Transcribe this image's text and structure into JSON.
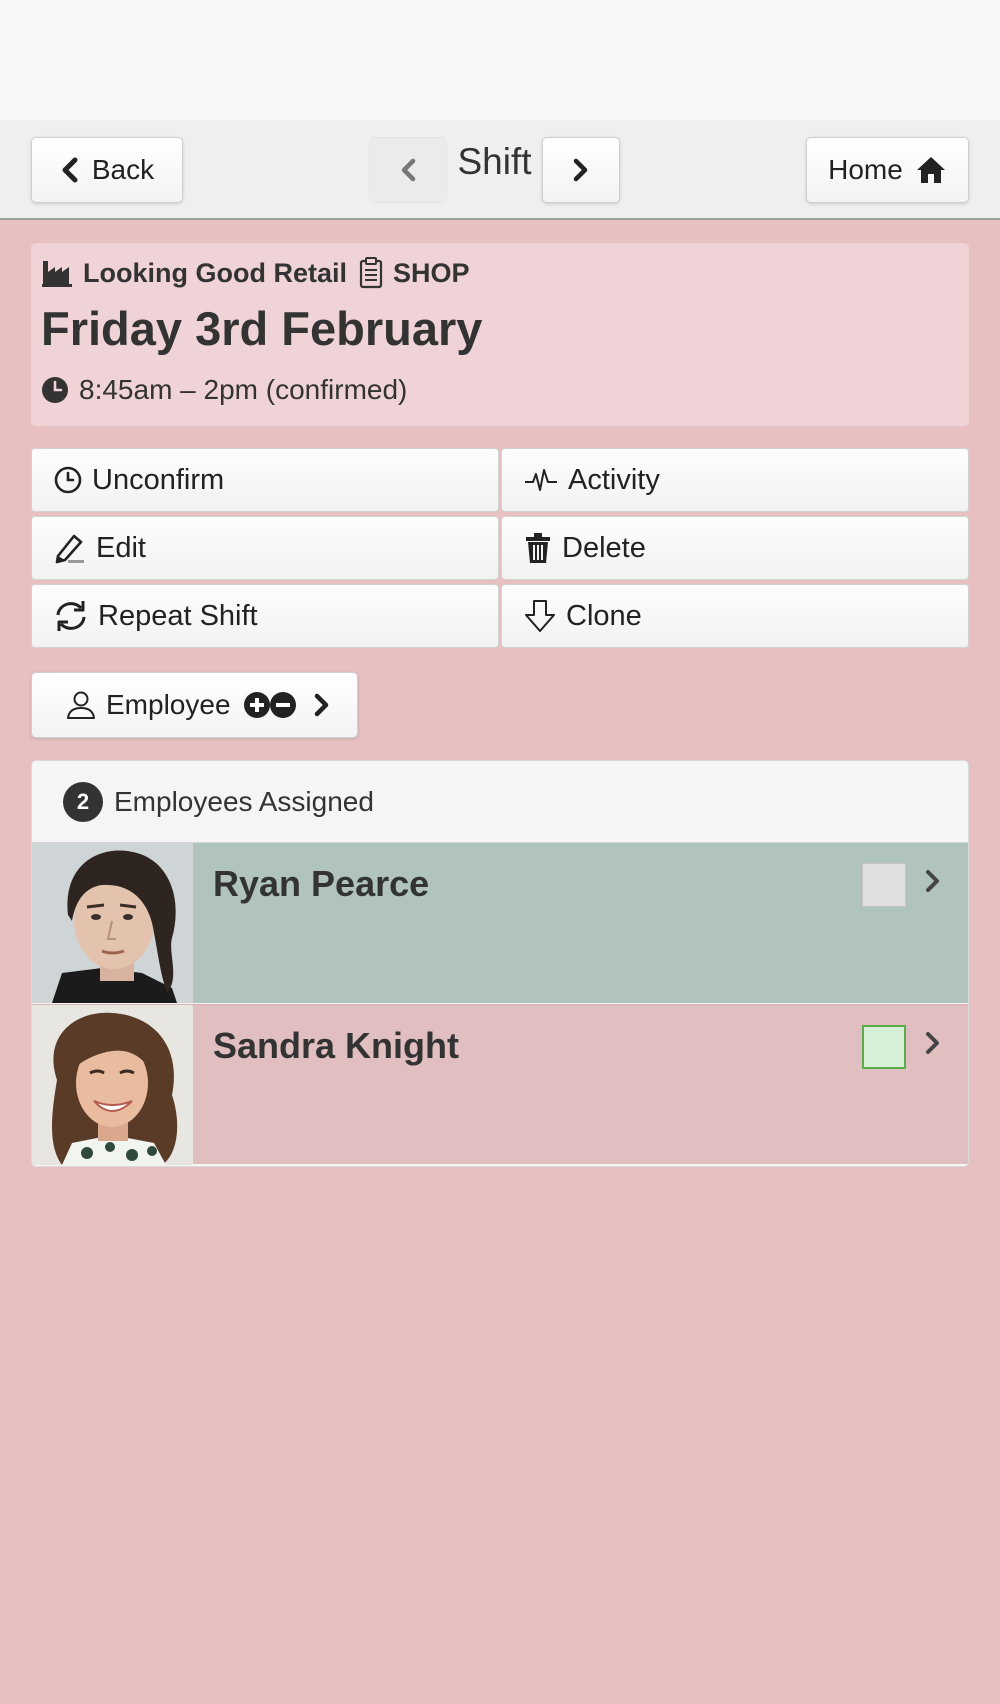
{
  "nav": {
    "back_label": "Back",
    "title": "Shift",
    "home_label": "Home"
  },
  "shift": {
    "company": "Looking Good Retail",
    "location": "SHOP",
    "date": "Friday 3rd February",
    "time": "8:45am – 2pm (confirmed)"
  },
  "actions": [
    {
      "label": "Unconfirm",
      "icon": "clock-icon"
    },
    {
      "label": "Activity",
      "icon": "activity-icon"
    },
    {
      "label": "Edit",
      "icon": "edit-icon"
    },
    {
      "label": "Delete",
      "icon": "trash-icon"
    },
    {
      "label": "Repeat Shift",
      "icon": "repeat-icon"
    },
    {
      "label": "Clone",
      "icon": "clone-icon"
    }
  ],
  "employee_button": {
    "label": "Employee"
  },
  "assigned": {
    "count": "2",
    "label": "Employees Assigned",
    "employees": [
      {
        "name": "Ryan Pearce",
        "row_color": "#b0c3be",
        "status_color": "#e0e0e0"
      },
      {
        "name": "Sandra Knight",
        "row_color": "#e1bfc0",
        "status_color": "#d6efd6"
      }
    ]
  }
}
